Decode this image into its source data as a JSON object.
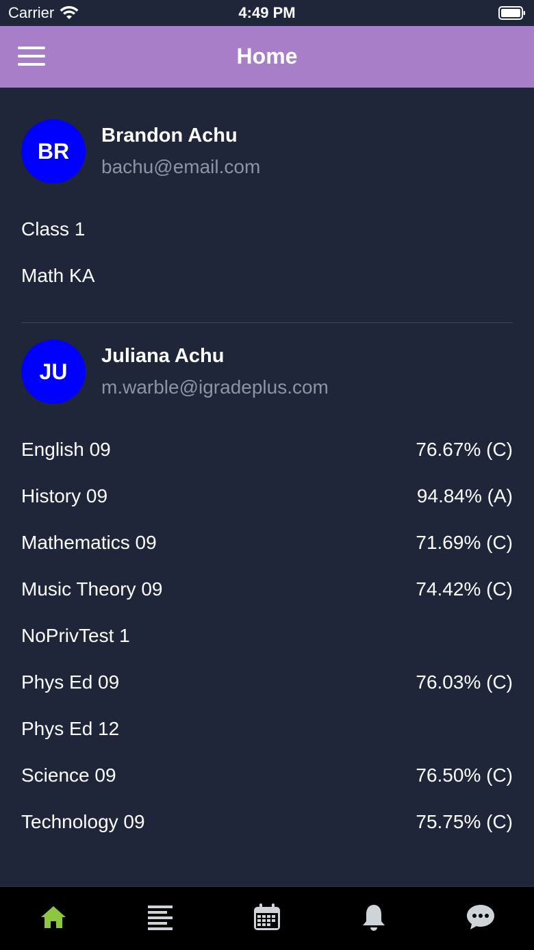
{
  "status_bar": {
    "carrier": "Carrier",
    "time": "4:49 PM"
  },
  "nav": {
    "title": "Home"
  },
  "students": [
    {
      "initials": "BR",
      "name": "Brandon Achu",
      "email": "bachu@email.com",
      "courses": [
        {
          "name": "Class 1",
          "grade": ""
        },
        {
          "name": "Math KA",
          "grade": ""
        }
      ]
    },
    {
      "initials": "JU",
      "name": "Juliana Achu",
      "email": "m.warble@igradeplus.com",
      "courses": [
        {
          "name": "English 09",
          "grade": "76.67% (C)"
        },
        {
          "name": "History 09",
          "grade": "94.84% (A)"
        },
        {
          "name": "Mathematics 09",
          "grade": "71.69% (C)"
        },
        {
          "name": "Music Theory 09",
          "grade": "74.42% (C)"
        },
        {
          "name": "NoPrivTest 1",
          "grade": ""
        },
        {
          "name": "Phys Ed 09",
          "grade": "76.03% (C)"
        },
        {
          "name": "Phys Ed 12",
          "grade": ""
        },
        {
          "name": "Science 09",
          "grade": "76.50% (C)"
        },
        {
          "name": "Technology 09",
          "grade": "75.75% (C)"
        }
      ]
    }
  ],
  "colors": {
    "background": "#1f2639",
    "nav_bar": "#a97ec8",
    "avatar": "#0000ff",
    "active_tab": "#8dc63f",
    "inactive_tab": "#cfd3da"
  },
  "tabs": [
    {
      "icon": "home-icon",
      "active": true
    },
    {
      "icon": "list-icon",
      "active": false
    },
    {
      "icon": "calendar-icon",
      "active": false
    },
    {
      "icon": "bell-icon",
      "active": false
    },
    {
      "icon": "chat-icon",
      "active": false
    }
  ]
}
